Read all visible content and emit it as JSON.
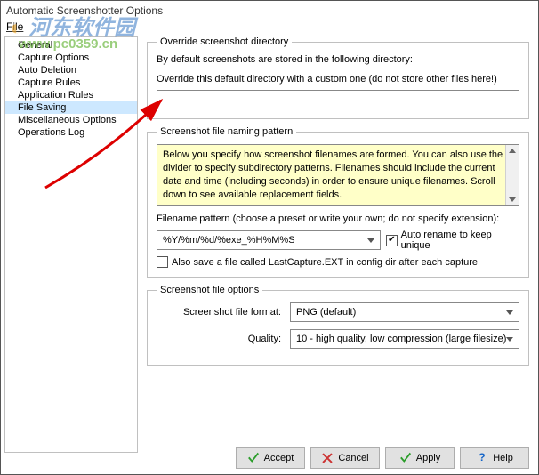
{
  "window": {
    "title": "Automatic Screenshotter Options",
    "menu_file": "File"
  },
  "sidebar": {
    "items": [
      {
        "label": "General"
      },
      {
        "label": "Capture Options"
      },
      {
        "label": "Auto Deletion"
      },
      {
        "label": "Capture Rules"
      },
      {
        "label": "Application Rules"
      },
      {
        "label": "File Saving"
      },
      {
        "label": "Miscellaneous Options"
      },
      {
        "label": "Operations Log"
      }
    ],
    "selected_index": 5
  },
  "override_section": {
    "legend": "Override screenshot directory",
    "description": "By default screenshots are stored in the following directory:",
    "override_label": "Override this default directory with a custom one (do not store other files here!)",
    "override_value": ""
  },
  "naming_section": {
    "legend": "Screenshot file naming pattern",
    "info_text": "Below you specify how screenshot filenames are formed.  You can also use the / divider to specify subdirectory patterns.  Filenames should include the current date and time (including seconds) in order to ensure unique filenames.  Scroll down to see available replacement fields.",
    "pattern_label": "Filename pattern (choose a preset or write your own; do not specify extension):",
    "pattern_value": "%Y/%m/%d/%exe_%H%M%S",
    "auto_rename_label": "Auto rename to keep unique",
    "auto_rename_checked": true,
    "lastcapture_label": "Also save a file called LastCapture.EXT in config dir after each capture",
    "lastcapture_checked": false
  },
  "options_section": {
    "legend": "Screenshot file options",
    "format_label": "Screenshot file format:",
    "format_value": "PNG (default)",
    "quality_label": "Quality:",
    "quality_value": "10 - high quality, low compression (large filesize)"
  },
  "buttons": {
    "accept": "Accept",
    "cancel": "Cancel",
    "apply": "Apply",
    "help": "Help"
  },
  "watermark": {
    "logo_text": "河东软件园",
    "url_text": "www.pc0359.cn"
  }
}
